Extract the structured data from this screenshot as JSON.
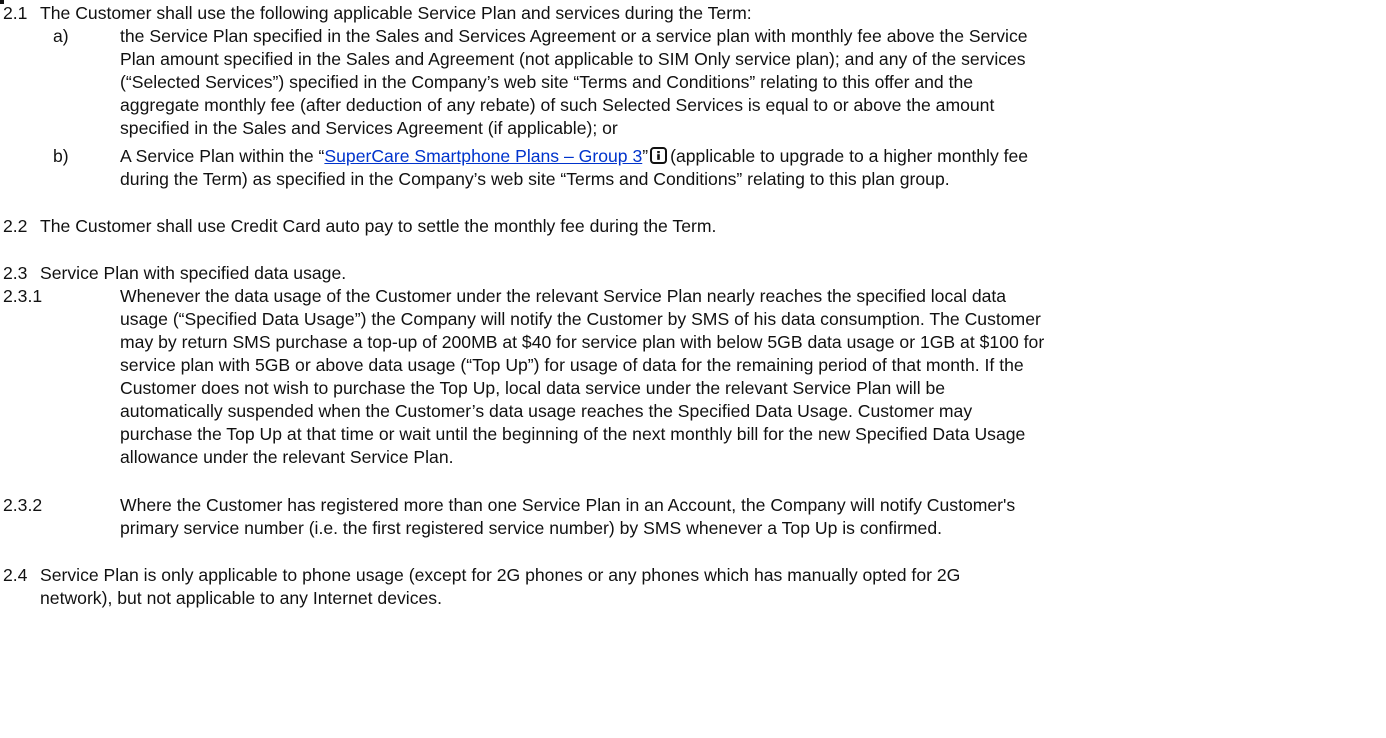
{
  "clause_2_1": {
    "number": "2.1",
    "intro": "The Customer shall use the following applicable Service Plan and services during the Term:",
    "a": {
      "label": "a)",
      "lines": [
        "the Service Plan specified in the Sales and Services Agreement or a service plan with monthly fee above the Service",
        "Plan amount specified in the Sales and Agreement (not applicable to SIM Only service plan); and any of the services",
        "(“Selected Services”) specified in the Company’s web site “Terms and Conditions” relating to this offer and the",
        "aggregate monthly fee (after deduction of any rebate) of such Selected Services is equal to or above the amount",
        "specified in the Sales and Services Agreement (if applicable); or"
      ]
    },
    "b": {
      "label": "b)",
      "prefix": "A Service Plan within the “",
      "link_text": "SuperCare Smartphone Plans – Group 3",
      "after_link": "”",
      "suffix": "(applicable to upgrade to a higher monthly fee",
      "line2": "during the Term) as specified in the Company’s web site “Terms and Conditions” relating to this plan group."
    }
  },
  "clause_2_2": {
    "number": "2.2",
    "text": "The Customer shall use Credit Card auto pay to settle the monthly fee during the Term."
  },
  "clause_2_3": {
    "number": "2.3",
    "text": "Service Plan with specified data usage.",
    "sub1": {
      "number": "2.3.1",
      "lines": [
        "Whenever the data usage of the Customer under the relevant Service Plan nearly reaches the specified local data",
        "usage (“Specified Data Usage”) the Company will notify the Customer by SMS of his data consumption. The Customer",
        "may by return SMS purchase a top-up of 200MB at $40 for service plan with below 5GB data usage or 1GB at $100 for",
        "service plan with 5GB or above data usage (“Top Up”) for usage of data for the remaining period of that month. If the",
        "Customer does not wish to purchase the Top Up, local data service under the relevant Service Plan will be",
        "automatically suspended when the Customer’s data usage reaches the Specified Data Usage. Customer may",
        "purchase the Top Up at that time or wait until the beginning of the next monthly bill for the new Specified Data Usage",
        "allowance under the relevant Service Plan."
      ]
    },
    "sub2": {
      "number": "2.3.2",
      "lines": [
        "Where the Customer has registered more than one Service Plan in an Account, the Company will notify Customer's",
        "primary service number (i.e. the first registered service number) by SMS whenever a Top Up is confirmed."
      ]
    }
  },
  "clause_2_4": {
    "number": "2.4",
    "lines": [
      "Service Plan is only applicable to phone usage (except for 2G phones or any phones which has manually opted for 2G",
      "network), but not applicable to any Internet devices."
    ]
  },
  "icons": {
    "info": "info-icon"
  }
}
